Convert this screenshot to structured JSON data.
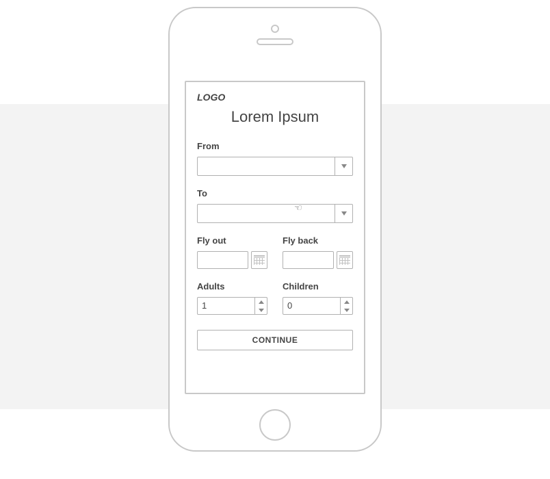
{
  "logo_text": "LOGO",
  "title": "Lorem Ipsum",
  "from": {
    "label": "From",
    "value": ""
  },
  "to": {
    "label": "To",
    "value": ""
  },
  "fly_out": {
    "label": "Fly out",
    "value": ""
  },
  "fly_back": {
    "label": "Fly back",
    "value": ""
  },
  "adults": {
    "label": "Adults",
    "value": "1"
  },
  "children": {
    "label": "Children",
    "value": "0"
  },
  "continue_label": "CONTINUE"
}
